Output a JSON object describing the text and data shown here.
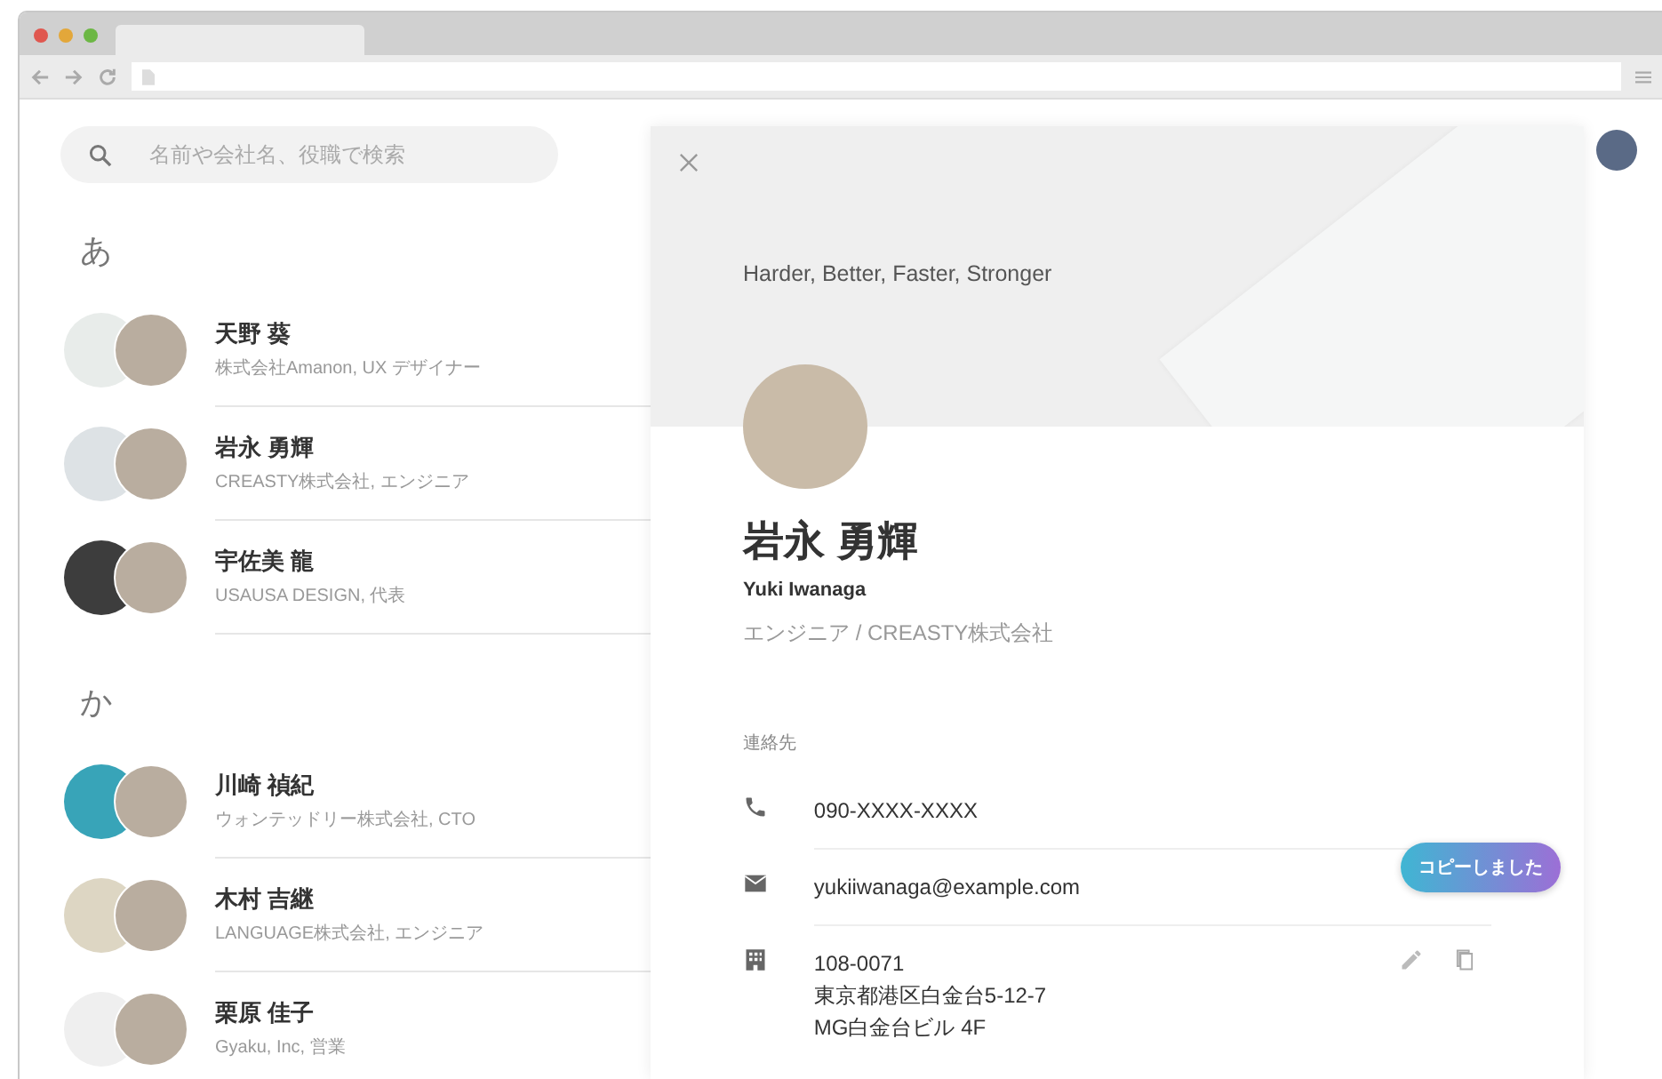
{
  "search": {
    "placeholder": "名前や会社名、役職で検索"
  },
  "sections": [
    {
      "heading": "あ",
      "contacts": [
        {
          "name": "天野 葵",
          "detail": "株式会社Amanon, UX デザイナー",
          "color": "#e8ecea"
        },
        {
          "name": "岩永 勇輝",
          "detail": "CREASTY株式会社, エンジニア",
          "color": "#dde2e5"
        },
        {
          "name": "宇佐美 龍",
          "detail": "USAUSA DESIGN, 代表",
          "color": "#3d3d3d"
        }
      ]
    },
    {
      "heading": "か",
      "contacts": [
        {
          "name": "川崎 禎紀",
          "detail": "ウォンテッドリー株式会社, CTO",
          "color": "#38a4b8"
        },
        {
          "name": "木村 吉継",
          "detail": "LANGUAGE株式会社, エンジニア",
          "color": "#ddd6c3"
        },
        {
          "name": "栗原 佳子",
          "detail": "Gyaku, Inc, 営業",
          "color": "#efefef"
        }
      ]
    }
  ],
  "detail": {
    "tagline": "Harder, Better, Faster, Stronger",
    "name": "岩永 勇輝",
    "name_romaji": "Yuki Iwanaga",
    "role": "エンジニア / CREASTY株式会社",
    "contact_heading": "連絡先",
    "contact_rows": [
      {
        "kind": "phone",
        "lines": [
          "090-XXXX-XXXX"
        ]
      },
      {
        "kind": "email",
        "lines": [
          "yukiiwanaga@example.com"
        ]
      },
      {
        "kind": "address",
        "lines": [
          "108-0071",
          "東京都港区白金台5-12-7",
          "MG白金台ビル 4F"
        ]
      }
    ],
    "toast": "コピーしました"
  }
}
